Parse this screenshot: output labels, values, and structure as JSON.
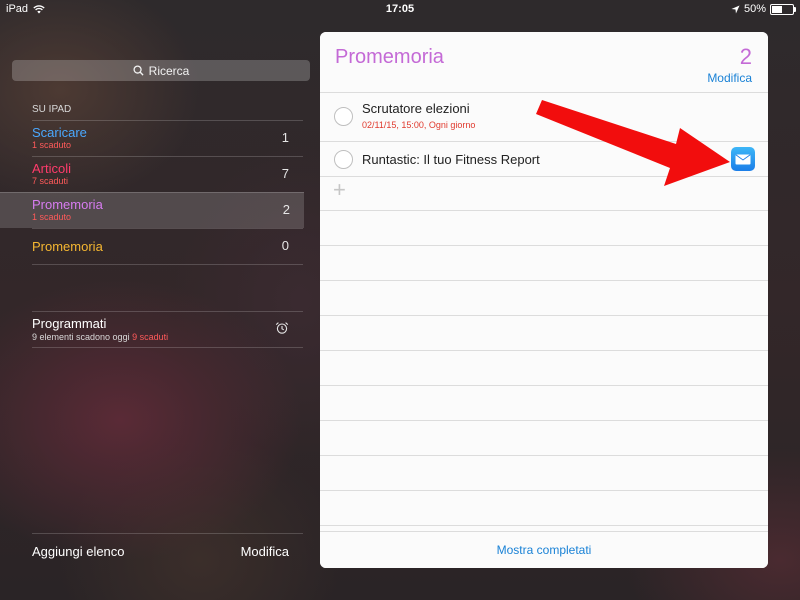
{
  "status_bar": {
    "device": "iPad",
    "time": "17:05",
    "battery": "50%",
    "battery_level": 0.5
  },
  "sidebar": {
    "search_label": "Ricerca",
    "section_title": "SU IPAD",
    "lists": [
      {
        "name": "Scaricare",
        "color": "#4aa8ff",
        "status": "1 scaduto",
        "count": "1"
      },
      {
        "name": "Articoli",
        "color": "#ff3b6b",
        "status": "7 scaduti",
        "count": "7"
      },
      {
        "name": "Promemoria",
        "color": "#d77cf0",
        "status": "1 scaduto",
        "count": "2",
        "selected": true
      },
      {
        "name": "Promemoria",
        "color": "#f5b731",
        "status": "",
        "count": "0"
      }
    ],
    "scheduled": {
      "name": "Programmati",
      "status_prefix": "9 elementi scadono oggi",
      "status_overdue": "9 scaduti"
    },
    "footer": {
      "add_list": "Aggiungi elenco",
      "edit": "Modifica"
    }
  },
  "detail": {
    "title": "Promemoria",
    "count": "2",
    "edit": "Modifica",
    "reminders": [
      {
        "title": "Scrutatore elezioni",
        "subtitle": "02/11/15, 15:00, Ogni giorno"
      },
      {
        "title": "Runtastic: Il tuo Fitness Report",
        "subtitle": "",
        "icon": "mail-icon"
      }
    ],
    "show_completed": "Mostra completati"
  },
  "colors": {
    "accent_purple": "#c46ad6",
    "link_blue": "#1a82d6",
    "overdue_red": "#ff5a5a",
    "arrow_red": "#f20d0d"
  }
}
